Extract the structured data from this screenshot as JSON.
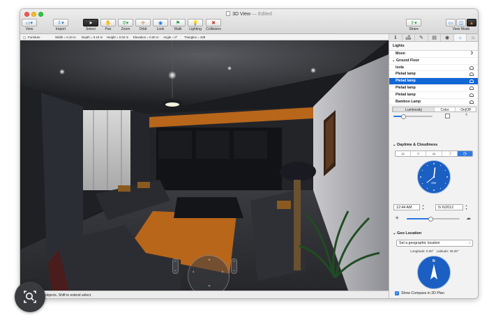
{
  "window": {
    "title": "3D View",
    "edited": "Edited"
  },
  "toolbar": {
    "view": "View",
    "import": "Import",
    "select": "Select",
    "pan": "Pan",
    "zoom": "Zoom",
    "orbit": "Orbit",
    "look": "Look",
    "walk": "Walk",
    "lighting": "Lighting",
    "collisions": "Collisions",
    "share": "Share",
    "view_mode": "View Mode"
  },
  "infobar": {
    "item": "Furniture",
    "width": "Width = 0.10 m",
    "depth": "Depth = 0.10 m",
    "height": "Height = 0.02 m",
    "elevation": "Elevation = 0.30 m",
    "angle": "Angle = 0°",
    "triangles": "Triangles = 428"
  },
  "status": {
    "text": "objects. Shift to extend select."
  },
  "lights": {
    "header": "Lights",
    "moon": "Moon",
    "group": "Ground Floor",
    "items": [
      {
        "label": "Isola"
      },
      {
        "label": "Plelad lamp"
      },
      {
        "label": "Plelad lamp"
      },
      {
        "label": "Plelad lamp"
      },
      {
        "label": "Plelad lamp"
      },
      {
        "label": "Bamboo Lamp"
      }
    ],
    "tabs": [
      "Luminosity",
      "Color",
      "On|Off"
    ],
    "luminosity": 0.25
  },
  "daytime": {
    "title": "Daytime & Cloudiness",
    "clock_label": "AM",
    "time": "12:44 AM",
    "date": "5/ 6/2012",
    "cloudiness": 0.45
  },
  "geo": {
    "title": "Geo Location",
    "button": "Set a geographic location",
    "longitude": "Longitude: 0.00°",
    "latitude": "Latitude: 45.00°",
    "compass_label": "N",
    "show_compass": "Show Compass in 2D Plan"
  },
  "colors": {
    "accent": "#1166d6",
    "clock": "#1c5fc2",
    "floor_wall": "#2a2b30",
    "orange_strip": "#b8661a"
  },
  "icons": {
    "lamp": "lamp-icon",
    "moon": "moon-icon"
  }
}
